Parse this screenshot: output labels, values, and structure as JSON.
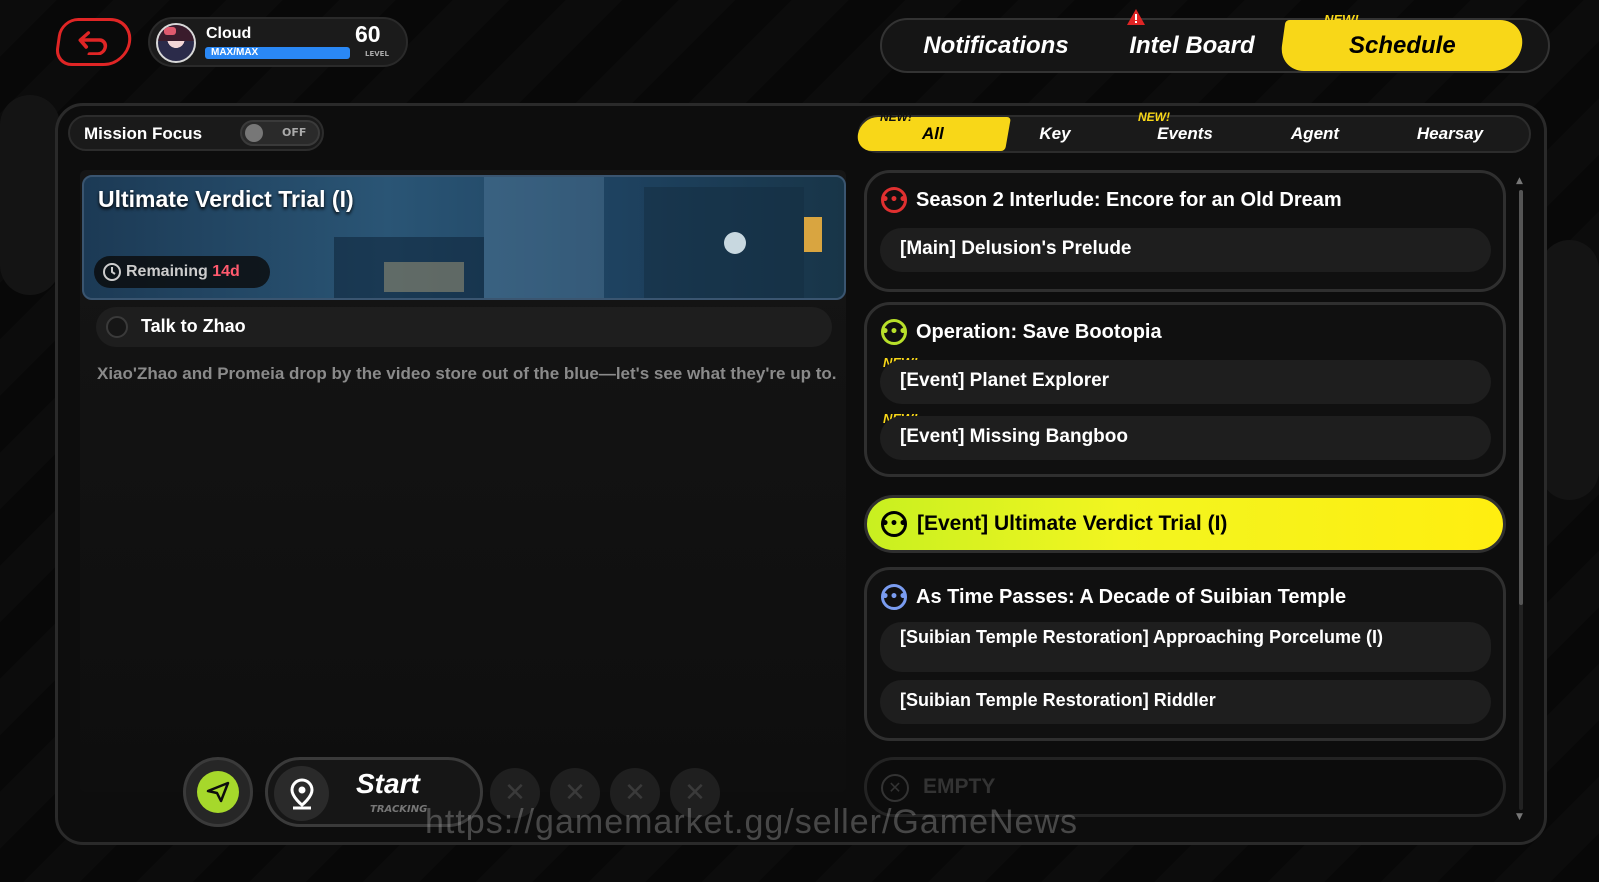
{
  "player": {
    "name": "Cloud",
    "xp_text": "MAX/MAX",
    "xp_progress": 1.0,
    "level": "60",
    "level_label": "LEVEL"
  },
  "top_tabs": [
    {
      "label": "Notifications",
      "active": false
    },
    {
      "label": "Intel Board",
      "active": false,
      "alert": true
    },
    {
      "label": "Schedule",
      "active": true,
      "badge": "NEW!"
    }
  ],
  "mission_focus": {
    "label": "Mission Focus",
    "state": "OFF"
  },
  "filter_tabs": [
    {
      "label": "All",
      "active": true,
      "badge": "NEW!"
    },
    {
      "label": "Key",
      "active": false
    },
    {
      "label": "Events",
      "active": false,
      "badge": "NEW!"
    },
    {
      "label": "Agent",
      "active": false
    },
    {
      "label": "Hearsay",
      "active": false
    }
  ],
  "detail": {
    "title": "Ultimate Verdict Trial (I)",
    "remaining_label": "Remaining",
    "remaining_value": "14d",
    "objective": "Talk to Zhao",
    "description": "Xiao'Zhao and Promeia drop by the video store out of the blue—let's see what they're up to."
  },
  "actions": {
    "start_label": "Start",
    "start_sub": "TRACKING",
    "empty_slots": 4
  },
  "groups": [
    {
      "title": "Season 2 Interlude: Encore for an Old Dream",
      "icon_color": "#e03030",
      "items": [
        {
          "label": "[Main] Delusion's Prelude",
          "new": false
        }
      ]
    },
    {
      "title": "Operation: Save Bootopia",
      "icon_color": "#b8e02a",
      "items": [
        {
          "label": "[Event] Planet Explorer",
          "new": true
        },
        {
          "label": "[Event] Missing Bangboo",
          "new": true
        }
      ]
    }
  ],
  "selected_mission": "[Event] Ultimate Verdict Trial (I)",
  "group3": {
    "title": "As Time Passes: A Decade of Suibian Temple",
    "icon_color": "#7a9cf0",
    "items": [
      {
        "label": "[Suibian Temple Restoration] Approaching Porcelume (I)"
      },
      {
        "label": "[Suibian Temple Restoration] Riddler"
      }
    ]
  },
  "empty_label": "EMPTY",
  "new_badge": "NEW!",
  "watermark": "https://gamemarket.gg/seller/GameNews",
  "colors": {
    "accent_yellow": "#f8d718",
    "highlight_green": "#c8f020",
    "alert_red": "#e02525"
  }
}
